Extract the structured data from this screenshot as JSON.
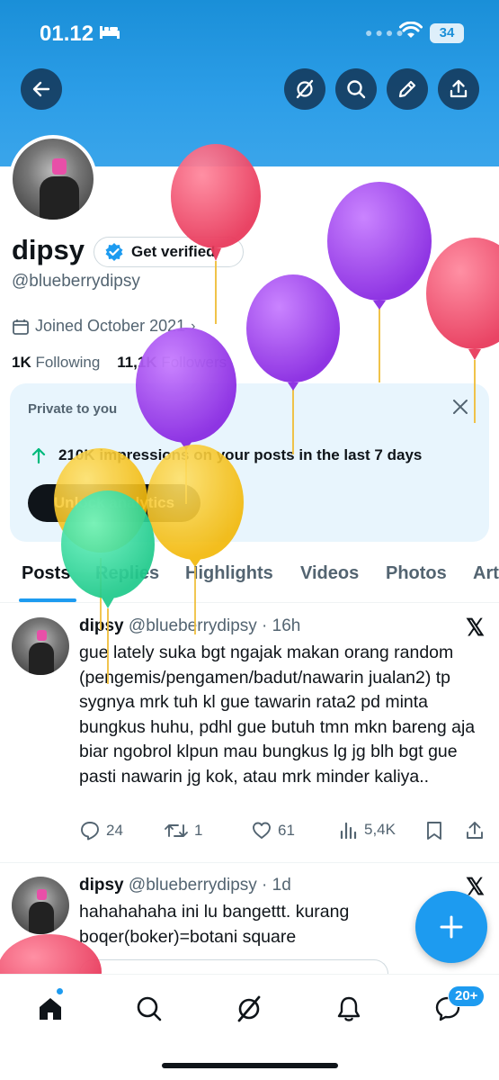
{
  "status_bar": {
    "time": "01.12",
    "battery": "34"
  },
  "profile": {
    "name": "dipsy",
    "verify_label": "Get verified",
    "handle": "@blueberrydipsy",
    "joined": "Joined October 2021",
    "following_count": "1K",
    "following_label": "Following",
    "followers_count": "11,1K",
    "followers_label": "Followers"
  },
  "private_card": {
    "title": "Private to you",
    "impressions": "210K impressions on your posts in the last 7 days",
    "button": "Unlock analytics"
  },
  "tabs": [
    "Posts",
    "Replies",
    "Highlights",
    "Videos",
    "Photos",
    "Art"
  ],
  "posts": [
    {
      "name": "dipsy",
      "handle_time": "@blueberrydipsy · 16h",
      "text": "gue lately suka bgt ngajak makan orang random (pengemis/pengamen/badut/nawarin jualan2) tp sygnya mrk tuh kl gue tawarin rata2 pd minta bungkus huhu, pdhl gue butuh tmn mkn bareng aja biar ngobrol klpun mau bungkus lg jg blh bgt gue pasti nawarin jg kok, atau mrk minder kaliya..",
      "replies": "24",
      "reposts": "1",
      "likes": "61",
      "views": "5,4K"
    },
    {
      "name": "dipsy",
      "handle_time": "@blueberrydipsy · 1d",
      "text": "hahahahaha ini lu bangettt. kurang boqer(boker)=botani square"
    }
  ],
  "nav": {
    "notifications_badge": "20+"
  },
  "icons": {
    "back": "arrow-left-icon",
    "grok": "grok-icon",
    "search": "search-icon",
    "edit": "pencil-icon",
    "share": "share-icon",
    "verified": "verified-badge-icon",
    "calendar": "calendar-icon",
    "close": "close-icon",
    "arrow_up": "arrow-up-icon",
    "x_logo": "x-logo-icon",
    "compose": "plus-icon",
    "home": "home-icon",
    "messages": "messages-icon",
    "bell": "bell-icon"
  },
  "colors": {
    "accent": "#1d9bf0",
    "banner": "#2d9ee8",
    "text": "#0f1419",
    "secondary": "#536471",
    "card_bg": "#e8f5fd"
  }
}
